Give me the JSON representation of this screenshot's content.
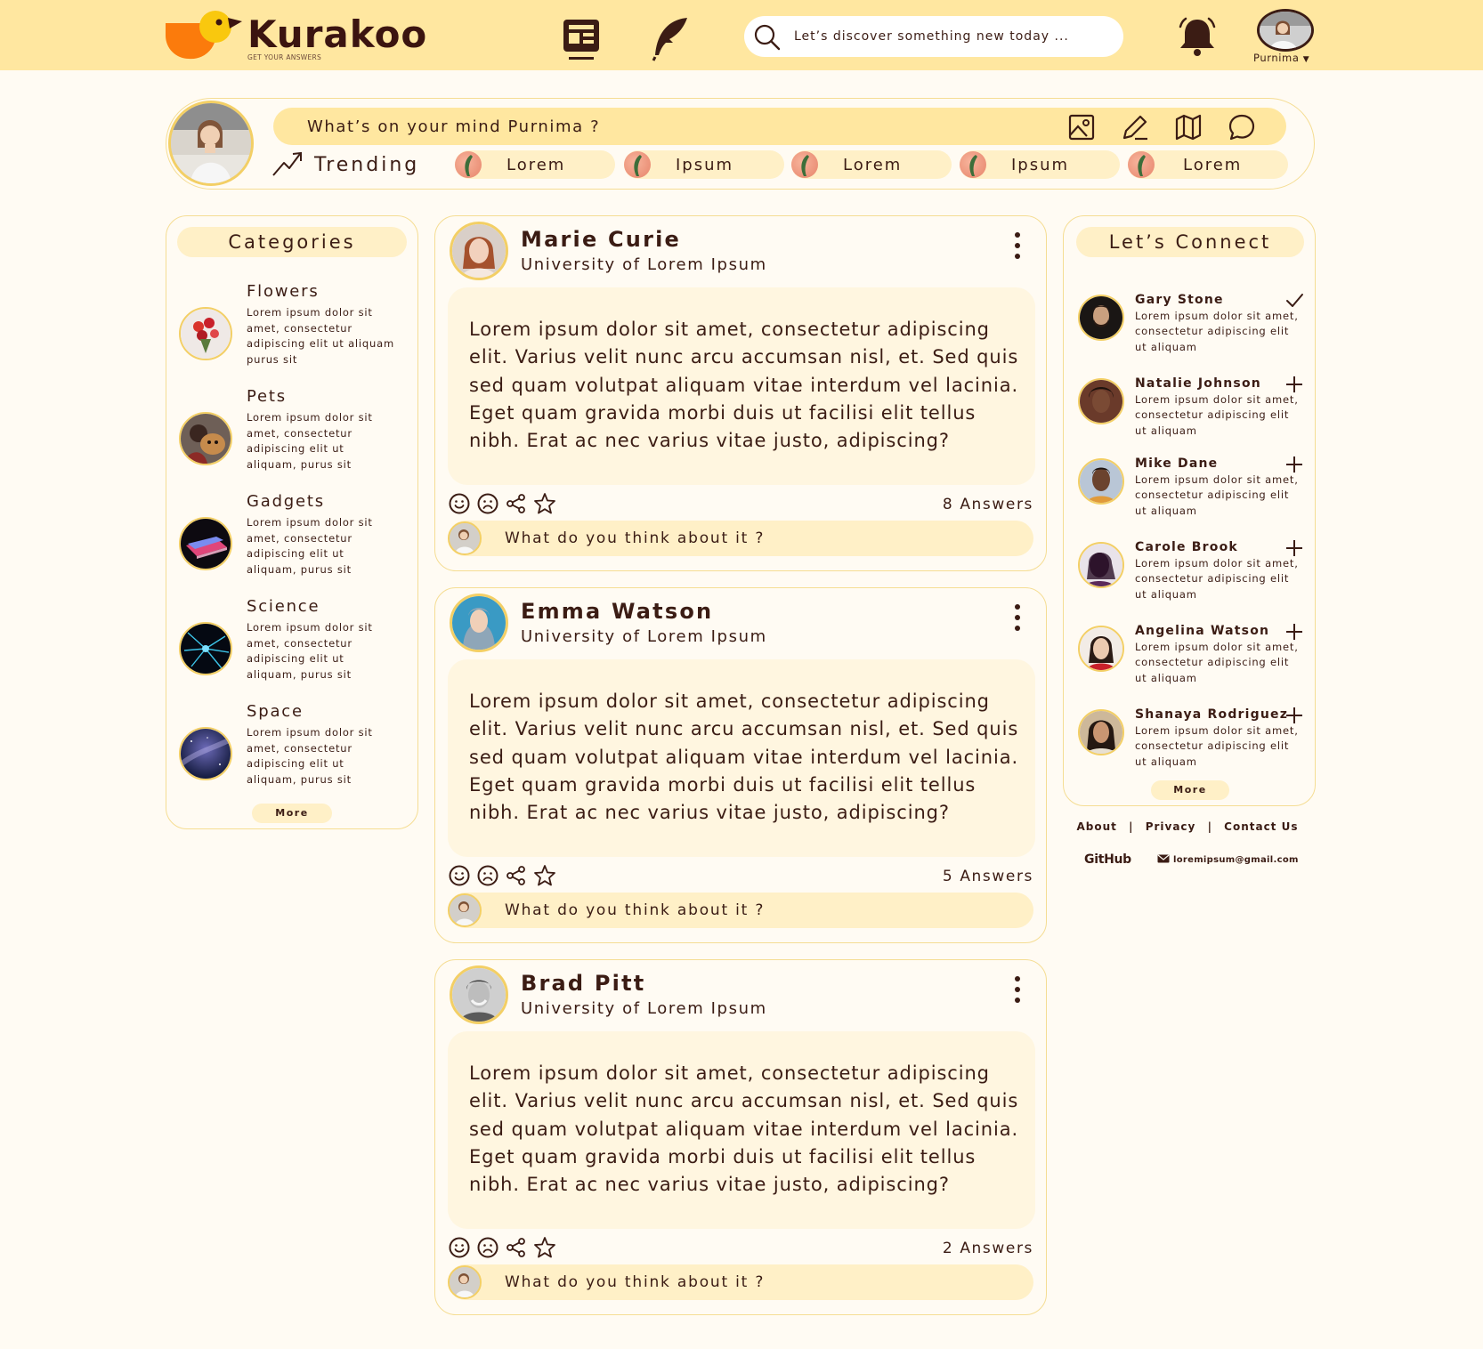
{
  "app": {
    "name": "Kurakoo",
    "tagline": "GET YOUR ANSWERS"
  },
  "header": {
    "search_placeholder": "Let’s discover something new today ...",
    "user_name": "Purnima",
    "icons": [
      "news-icon",
      "quill-icon",
      "search-icon",
      "bell-icon",
      "chevron-down-icon"
    ]
  },
  "composer": {
    "prompt": "What’s on your mind Purnima ?",
    "tools": [
      "image-icon",
      "pencil-icon",
      "map-icon",
      "chat-icon"
    ],
    "trending_label": "Trending",
    "trending_chips": [
      "Lorem",
      "Ipsum",
      "Lorem",
      "Ipsum",
      "Lorem"
    ]
  },
  "categories": {
    "title": "Categories",
    "items": [
      {
        "title": "Flowers",
        "desc": "Lorem ipsum dolor sit amet, consectetur adipiscing elit ut aliquam purus sit"
      },
      {
        "title": "Pets",
        "desc": "Lorem ipsum dolor sit amet, consectetur adipiscing elit ut aliquam, purus sit"
      },
      {
        "title": "Gadgets",
        "desc": "Lorem ipsum dolor sit amet, consectetur adipiscing elit ut aliquam, purus sit"
      },
      {
        "title": "Science",
        "desc": "Lorem ipsum dolor sit amet, consectetur adipiscing elit ut aliquam, purus sit"
      },
      {
        "title": "Space",
        "desc": "Lorem ipsum dolor sit amet, consectetur adipiscing elit ut aliquam, purus sit"
      }
    ],
    "more": "More"
  },
  "posts": [
    {
      "name": "Marie Curie",
      "university": "University of Lorem Ipsum",
      "body": "Lorem ipsum dolor sit amet, consectetur adipiscing elit. Varius velit nunc arcu accumsan nisl, et. Sed quis sed quam volutpat aliquam vitae interdum vel lacinia. Eget quam gravida morbi duis ut facilisi elit tellus nibh. Erat ac nec varius vitae justo, adipiscing?",
      "answers": "8 Answers",
      "reply_placeholder": "What do you think about it ?"
    },
    {
      "name": "Emma Watson",
      "university": "University of Lorem Ipsum",
      "body": "Lorem ipsum dolor sit amet, consectetur adipiscing elit. Varius velit nunc arcu accumsan nisl, et. Sed quis sed quam volutpat aliquam vitae interdum vel lacinia. Eget quam gravida morbi duis ut facilisi elit tellus nibh. Erat ac nec varius vitae justo, adipiscing?",
      "answers": "5 Answers",
      "reply_placeholder": "What do you think about it ?"
    },
    {
      "name": "Brad Pitt",
      "university": "University of Lorem Ipsum",
      "body": "Lorem ipsum dolor sit amet, consectetur adipiscing elit. Varius velit nunc arcu accumsan nisl, et. Sed quis sed quam volutpat aliquam vitae interdum vel lacinia. Eget quam gravida morbi duis ut facilisi elit tellus nibh. Erat ac nec varius vitae justo, adipiscing?",
      "answers": "2 Answers",
      "reply_placeholder": "What do you think about it ?"
    }
  ],
  "connect": {
    "title": "Let’s Connect",
    "people": [
      {
        "name": "Gary Stone",
        "desc": "Lorem ipsum dolor sit amet, consectetur adipiscing elit ut aliquam",
        "action": "check-icon"
      },
      {
        "name": "Natalie Johnson",
        "desc": "Lorem ipsum dolor sit amet, consectetur adipiscing elit ut aliquam",
        "action": "plus-icon"
      },
      {
        "name": "Mike Dane",
        "desc": "Lorem ipsum dolor sit amet, consectetur adipiscing elit ut aliquam",
        "action": "plus-icon"
      },
      {
        "name": "Carole Brook",
        "desc": "Lorem ipsum dolor sit amet, consectetur adipiscing elit ut aliquam",
        "action": "plus-icon"
      },
      {
        "name": "Angelina Watson",
        "desc": "Lorem ipsum dolor sit amet, consectetur adipiscing elit ut aliquam",
        "action": "plus-icon"
      },
      {
        "name": "Shanaya Rodriguez",
        "desc": "Lorem ipsum dolor sit amet, consectetur adipiscing elit ut aliquam",
        "action": "plus-icon"
      }
    ],
    "more": "More"
  },
  "footer": {
    "about": "About",
    "privacy": "Privacy",
    "contact": "Contact Us",
    "separator": "|",
    "github": "GitHub",
    "email": "loremipsum@gmail.com"
  },
  "colors": {
    "header_bg": "#ffe7a0",
    "page_bg": "#fffbf3",
    "text": "#3b1c14",
    "border": "#f5dd93",
    "pill": "#fff0c7",
    "logo_orange": "#fb7b0c",
    "logo_yellow": "#f9c80e"
  }
}
